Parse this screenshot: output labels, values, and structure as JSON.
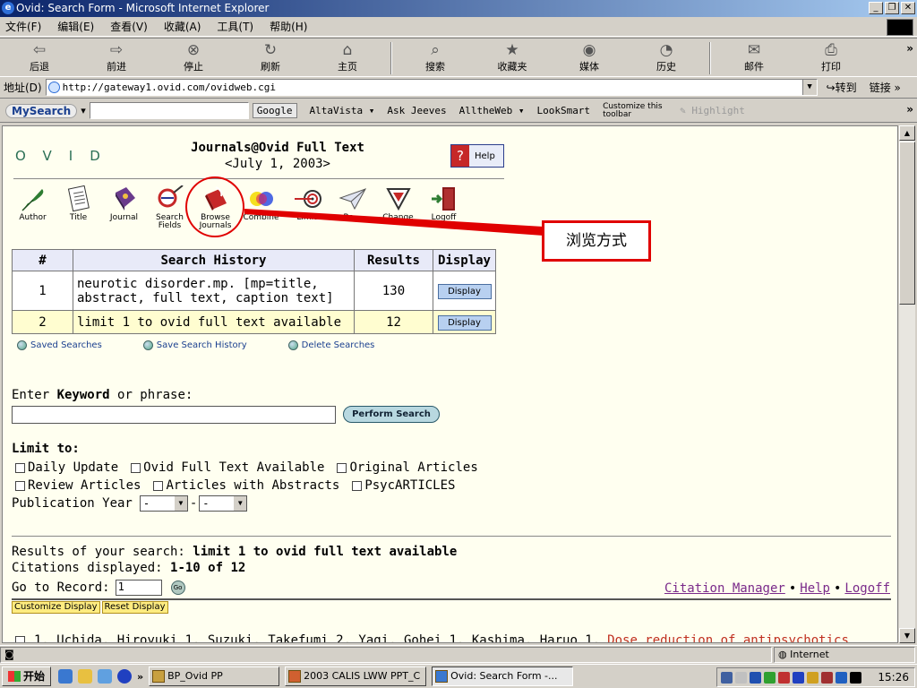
{
  "window": {
    "title": "Ovid: Search Form - Microsoft Internet Explorer"
  },
  "menu": [
    "文件(F)",
    "编辑(E)",
    "查看(V)",
    "收藏(A)",
    "工具(T)",
    "帮助(H)"
  ],
  "toolbar": {
    "back": "后退",
    "forward": "前进",
    "stop": "停止",
    "refresh": "刷新",
    "home": "主页",
    "search": "搜索",
    "favorites": "收藏夹",
    "media": "媒体",
    "history": "历史",
    "mail": "邮件",
    "print": "打印"
  },
  "address": {
    "label": "地址(D)",
    "url": "http://gateway1.ovid.com/ovidweb.cgi",
    "go": "转到",
    "links": "链接"
  },
  "googlebar": {
    "mysearch": "MySearch",
    "google": "Google",
    "altavista": "AltaVista",
    "askjeeves": "Ask Jeeves",
    "alltheweb": "AlltheWeb",
    "looksmart": "LookSmart",
    "customize": "Customize this toolbar",
    "highlight": "Highlight"
  },
  "page": {
    "logo": "OVID",
    "title": "Journals@Ovid Full Text",
    "date": "<July 1, 2003>",
    "help": "Help",
    "nav": [
      {
        "label": "Author",
        "icon": "quill-icon"
      },
      {
        "label": "Title",
        "icon": "document-icon"
      },
      {
        "label": "Journal",
        "icon": "journal-icon"
      },
      {
        "label": "Search\nFields",
        "icon": "search-fields-icon"
      },
      {
        "label": "Browse\nJournals",
        "icon": "browse-journals-icon"
      },
      {
        "label": "Combine",
        "icon": "combine-icon"
      },
      {
        "label": "Limit",
        "icon": "target-icon"
      },
      {
        "label": "Ba...",
        "icon": "paper-plane-icon"
      },
      {
        "label": "Change",
        "icon": "change-icon"
      },
      {
        "label": "Logoff",
        "icon": "door-icon"
      }
    ],
    "callout": "浏览方式",
    "history": {
      "headers": [
        "#",
        "Search History",
        "Results",
        "Display"
      ],
      "rows": [
        {
          "num": "1",
          "query": "neurotic disorder.mp. [mp=title, abstract, full text, caption text]",
          "results": "130",
          "display": "Display"
        },
        {
          "num": "2",
          "query": "limit 1 to ovid full text available",
          "results": "12",
          "display": "Display"
        }
      ]
    },
    "save_links": [
      "Saved Searches",
      "Save Search History",
      "Delete Searches"
    ],
    "keyword_prefix": "Enter ",
    "keyword_bold": "Keyword",
    "keyword_suffix": " or phrase:",
    "perform": "Perform Search",
    "limit_label": "Limit to:",
    "limits_row1": [
      "Daily Update",
      "Ovid Full Text Available",
      "Original Articles"
    ],
    "limits_row2": [
      "Review Articles",
      "Articles with Abstracts",
      "PsycARTICLES"
    ],
    "pubyear_label": "Publication Year",
    "pubyear_from": "-",
    "pubyear_to": "-",
    "results_prefix": "Results of your search: ",
    "results_query": "limit 1 to ovid full text available",
    "citations_prefix": "Citations displayed: ",
    "citations_range": "1-10 of 12",
    "goto_label": "Go to Record:",
    "goto_value": "1",
    "go": "Go",
    "links": {
      "citation_manager": "Citation Manager",
      "help": "Help",
      "logoff": "Logoff"
    },
    "customize_display": "Customize Display",
    "reset_display": "Reset Display",
    "citation1_authors": "1. Uchida, Hiroyuki 1. Suzuki, Takefumi 2. Yagi, Gohei 1. Kashima, Haruo 1.",
    "citation1_title": "Dose reduction of antipsychotics"
  },
  "status": {
    "zone": "Internet"
  },
  "taskbar": {
    "start": "开始",
    "tasks": [
      "BP_Ovid PP",
      "2003 CALIS LWW PPT_C",
      "Ovid: Search Form -..."
    ],
    "clock": "15:26"
  }
}
